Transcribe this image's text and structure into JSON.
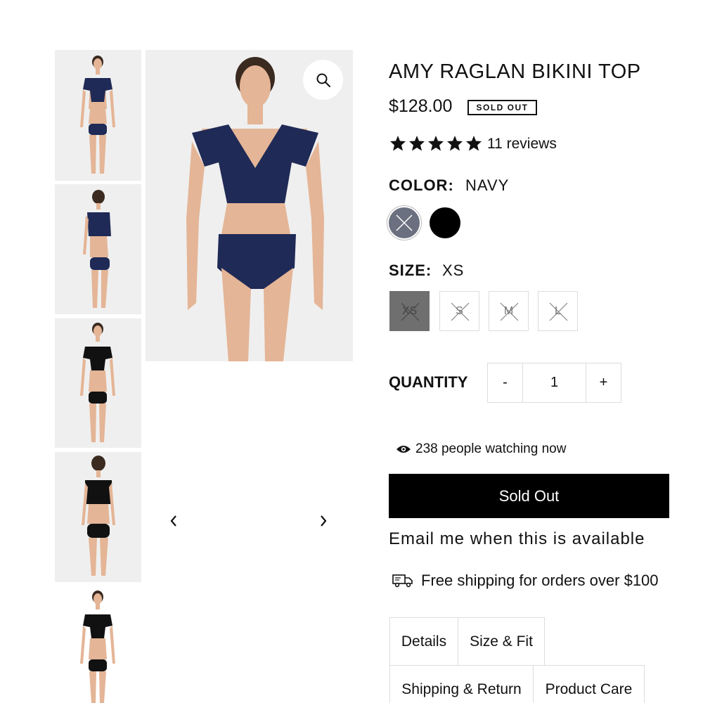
{
  "product": {
    "title": "AMY RAGLAN BIKINI TOP",
    "price": "$128.00",
    "badge": "SOLD OUT",
    "rating": 5,
    "reviews": "11 reviews"
  },
  "color": {
    "label": "COLOR:",
    "selected": "NAVY",
    "swatches": [
      {
        "name": "navy",
        "hex": "#6b7080",
        "available": false
      },
      {
        "name": "black",
        "hex": "#000000",
        "available": true
      }
    ]
  },
  "size": {
    "label": "SIZE:",
    "selected": "XS",
    "options": [
      "XS",
      "S",
      "M",
      "L"
    ]
  },
  "quantity": {
    "label": "QUANTITY",
    "minus": "-",
    "value": "1",
    "plus": "+"
  },
  "watching": "238 people watching now",
  "sold_out_button": "Sold Out",
  "email_link": "Email me when this is available",
  "shipping": "Free shipping for orders over $100",
  "tabs": [
    "Details",
    "Size & Fit",
    "Shipping & Return",
    "Product Care"
  ],
  "gallery": {
    "prev_icon": "chevron-left-icon",
    "next_icon": "chevron-right-icon",
    "zoom_icon": "magnifier-icon"
  },
  "colors": {
    "navy_garment": "#1f2a56",
    "black_garment": "#111111",
    "skin": "#e4b596",
    "hair": "#3a2a20",
    "image_bg": "#efefef"
  }
}
